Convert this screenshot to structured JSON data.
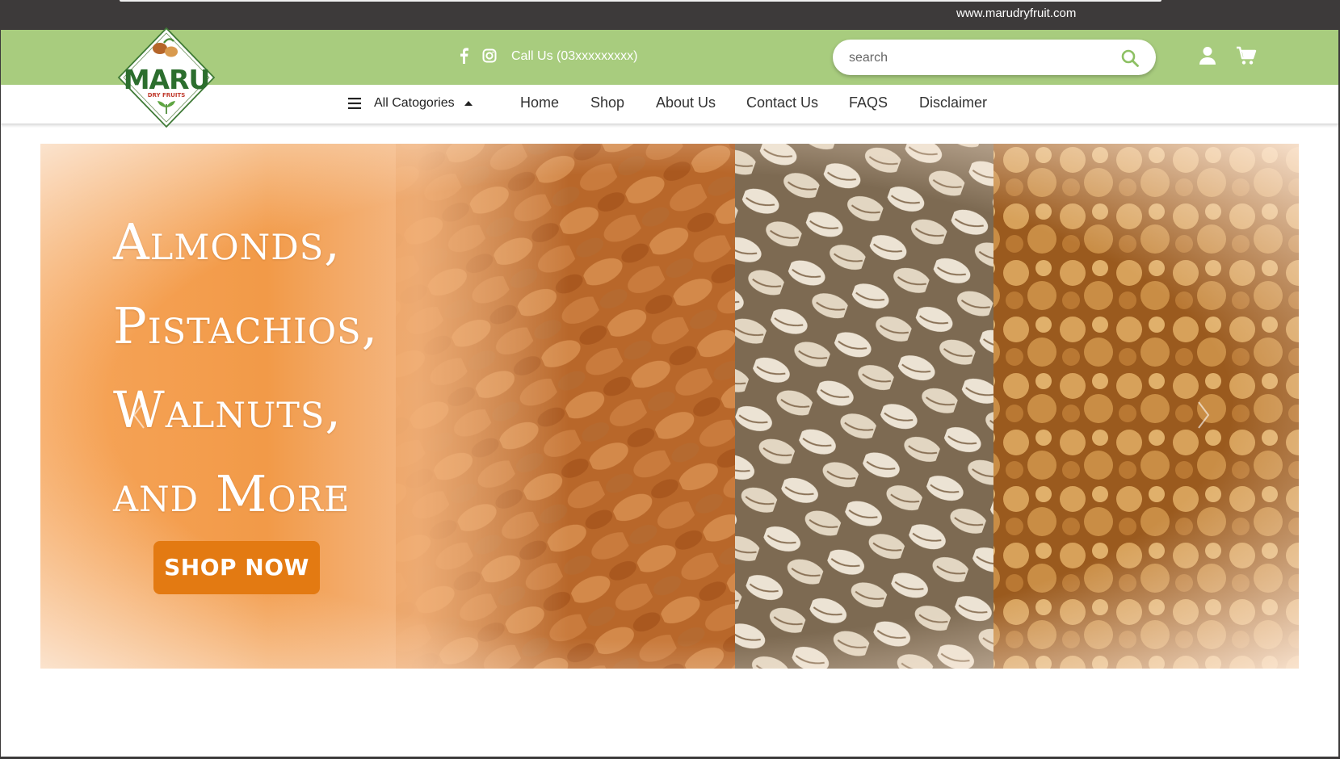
{
  "browser": {
    "url": "www.marudryfruit.com"
  },
  "header": {
    "logo": {
      "brand": "MARU",
      "tagline": "DRY FRUITS"
    },
    "social": [
      {
        "icon": "facebook-icon"
      },
      {
        "icon": "instagram-icon"
      }
    ],
    "call_us": "Call Us (03xxxxxxxxx)",
    "search": {
      "placeholder": "search",
      "value": ""
    },
    "user_icon": "user-icon",
    "cart_icon": "cart-icon"
  },
  "nav": {
    "categories_label": "All Catogories",
    "links": [
      "Home",
      "Shop",
      "About Us",
      "Contact Us",
      "FAQS",
      "Disclaimer"
    ]
  },
  "banner": {
    "headline": [
      "Almonds,",
      "Pistachios,",
      "Walnuts,",
      "and More"
    ],
    "cta": "SHOP NOW"
  },
  "colors": {
    "header_green": "#a8cc7e",
    "top_bar": "#3d3a3a",
    "cta_orange": "#e37a12",
    "search_icon": "#8dc063"
  }
}
